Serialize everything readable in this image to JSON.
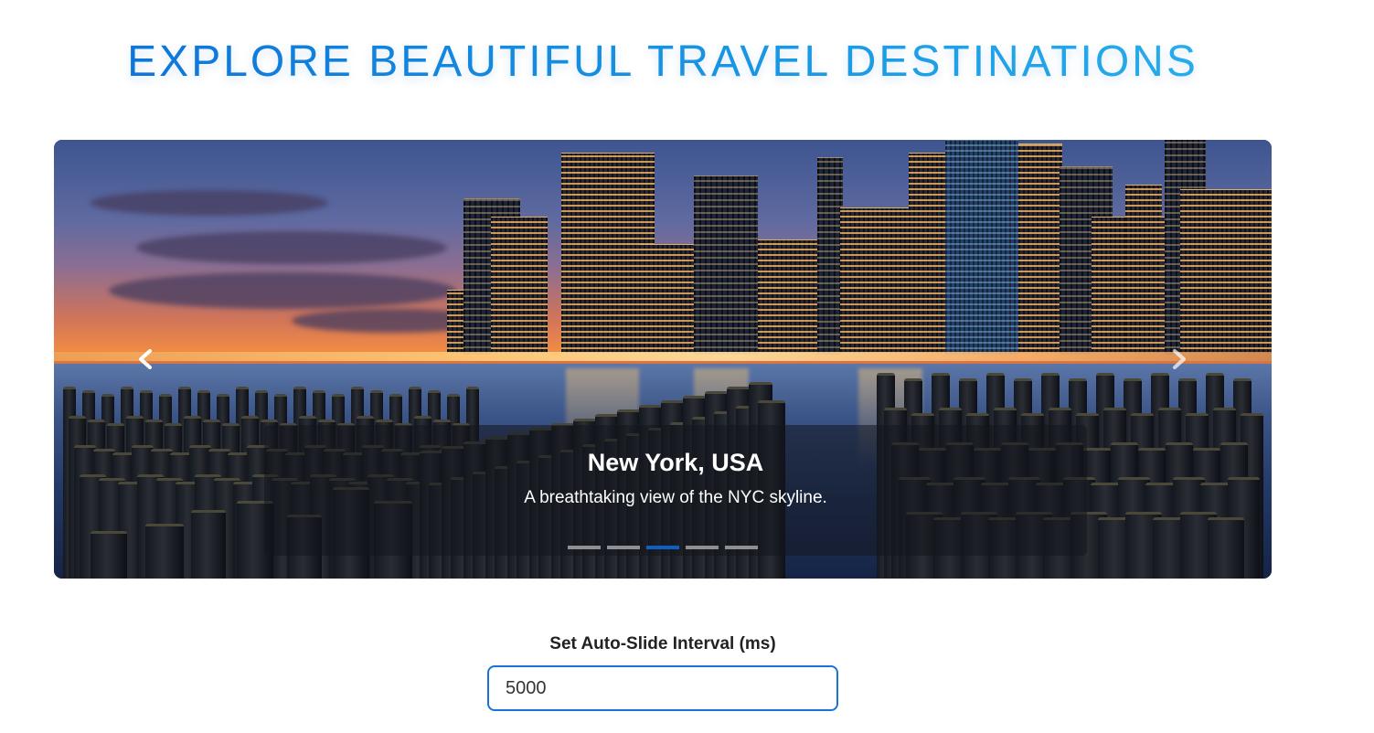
{
  "page": {
    "title": "EXPLORE BEAUTIFUL TRAVEL DESTINATIONS",
    "accent_color": "#0a84e0"
  },
  "carousel": {
    "slide": {
      "image": "new-york-skyline-at-dusk",
      "title": "New York, USA",
      "description": "A breathtaking view of the NYC skyline."
    },
    "indicators": {
      "count": 5,
      "active_index": 2,
      "active_color": "#0d5fc4"
    },
    "prev_icon": "chevron-left-icon",
    "next_icon": "chevron-right-icon"
  },
  "settings": {
    "interval_label": "Set Auto-Slide Interval (ms)",
    "interval_value": "5000"
  }
}
